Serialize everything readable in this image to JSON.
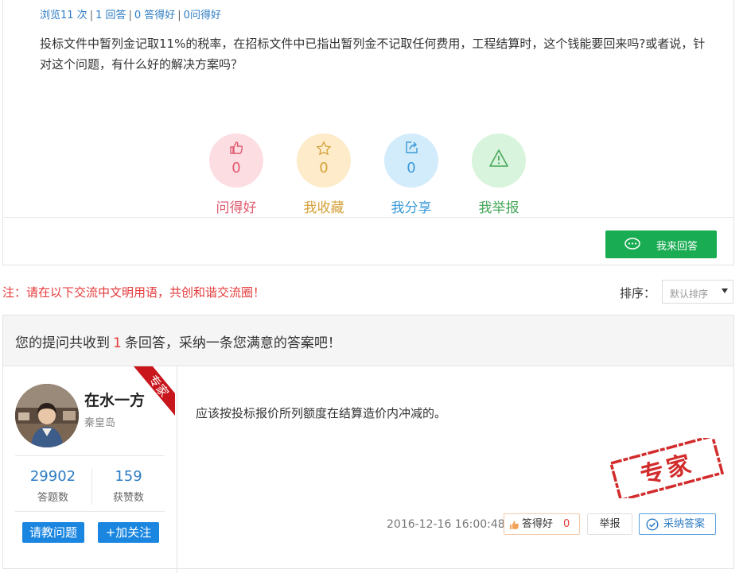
{
  "question": {
    "meta": {
      "views": "浏览11 次",
      "answers": "1 回答",
      "good_answers": "0 答得好",
      "good_question": "0问得好"
    },
    "text": "投标文件中暂列金记取11%的税率，在招标文件中已指出暂列金不记取任何费用，工程结算时，这个钱能要回来吗?或者说，针对这个问题，有什么好的解决方案吗？",
    "stats": [
      {
        "icon": "thumbs-up-icon",
        "count": "0",
        "label": "问得好",
        "color": "#e05a6e"
      },
      {
        "icon": "star-icon",
        "count": "0",
        "label": "我收藏",
        "color": "#d4a23b"
      },
      {
        "icon": "share-icon",
        "count": "0",
        "label": "我分享",
        "color": "#3b9ad8"
      },
      {
        "icon": "warning-icon",
        "count": "",
        "label": "我举报",
        "color": "#45a85a"
      }
    ],
    "answer_button": "我来回答"
  },
  "notice": "注：请在以下交流中文明用语，共创和谐交流圈！",
  "sort": {
    "label": "排序：",
    "selected": "默认排序"
  },
  "answers_header": {
    "prefix": "您的提问共收到",
    "count": "1",
    "suffix": "条回答，采纳一条您满意的答案吧！"
  },
  "answer": {
    "user": {
      "name": "在水一方",
      "location": "秦皇岛",
      "badge": "专家",
      "answers_count": "29902",
      "answers_label": "答题数",
      "likes_count": "159",
      "likes_label": "获赞数",
      "ask_button": "请教问题",
      "follow_button": "+加关注"
    },
    "text": "应该按投标报价所列额度在结算造价内冲减的。",
    "stamp": "专家",
    "time": "2016-12-16 16:00:48",
    "good_label": "答得好",
    "good_count": "0",
    "report_label": "举报",
    "adopt_label": "采纳答案"
  },
  "colors": {
    "green": "#1aac52",
    "blue": "#1a86e0",
    "red": "#e5393a",
    "link": "#2e7cc4"
  }
}
